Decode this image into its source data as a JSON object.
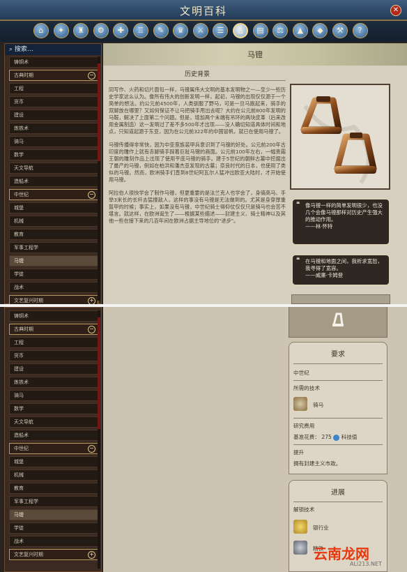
{
  "window": {
    "title": "文明百科",
    "close_icon": "close-icon"
  },
  "category_icons": [
    "home-icon",
    "wonder-icon",
    "civilization-icon",
    "tech-icon",
    "religion-icon",
    "city-icon",
    "culture-icon",
    "great-person-icon",
    "unit-icon",
    "policy-icon",
    "stirrups-icon",
    "building-icon",
    "government-icon",
    "terrain-icon",
    "resource-icon",
    "improvement-icon",
    "concept-icon"
  ],
  "selected_category": 10,
  "sidebar": {
    "search_label": "搜索…",
    "top_items": [
      {
        "label": "铸铜术",
        "type": "item"
      },
      {
        "label": "古典时期",
        "type": "era",
        "toggle": "−"
      },
      {
        "label": "工程",
        "type": "item"
      },
      {
        "label": "货币",
        "type": "item"
      },
      {
        "label": "建设",
        "type": "item"
      },
      {
        "label": "炼铁术",
        "type": "item"
      },
      {
        "label": "骑马",
        "type": "item"
      },
      {
        "label": "数学",
        "type": "item"
      },
      {
        "label": "天文导航",
        "type": "item"
      },
      {
        "label": "造船术",
        "type": "item"
      },
      {
        "label": "中世纪",
        "type": "era",
        "toggle": "−"
      },
      {
        "label": "城堡",
        "type": "item"
      },
      {
        "label": "机械",
        "type": "item"
      },
      {
        "label": "教育",
        "type": "item"
      },
      {
        "label": "军事工程学",
        "type": "item"
      },
      {
        "label": "马镫",
        "type": "item",
        "selected": true
      },
      {
        "label": "学徒",
        "type": "item"
      },
      {
        "label": "战术",
        "type": "item"
      },
      {
        "label": "文艺复兴时期",
        "type": "era",
        "toggle": "+"
      }
    ],
    "bottom_items": [
      {
        "label": "铸铜术",
        "type": "item"
      },
      {
        "label": "古典时期",
        "type": "era",
        "toggle": "−"
      },
      {
        "label": "工程",
        "type": "item"
      },
      {
        "label": "货币",
        "type": "item"
      },
      {
        "label": "建设",
        "type": "item"
      },
      {
        "label": "炼铁术",
        "type": "item"
      },
      {
        "label": "骑马",
        "type": "item"
      },
      {
        "label": "数学",
        "type": "item"
      },
      {
        "label": "天文导航",
        "type": "item"
      },
      {
        "label": "造船术",
        "type": "item"
      },
      {
        "label": "中世纪",
        "type": "era",
        "toggle": "−"
      },
      {
        "label": "城堡",
        "type": "item"
      },
      {
        "label": "机械",
        "type": "item"
      },
      {
        "label": "教育",
        "type": "item"
      },
      {
        "label": "军事工程学",
        "type": "item"
      },
      {
        "label": "马镫",
        "type": "item",
        "selected": true
      },
      {
        "label": "学徒",
        "type": "item"
      },
      {
        "label": "战术",
        "type": "item"
      },
      {
        "label": "文艺复兴时期",
        "type": "era",
        "toggle": "+"
      }
    ]
  },
  "article": {
    "title": "马镫",
    "section_heading": "历史背景",
    "paragraphs": [
      "同写作、火药和切片面包一样，马镫属伟大文明的基本发明物之一—至少一些历史学家这么认为。像所有伟大的创新发明一样，起初，马镫的出现仅仅源于一个简单的想法。约公元前4500年，人类驯服了野马，可是一旦马跑起来，骑手的双脚放在哪里？又如何保证不让马把骑手甩出去呢？大约在公元前800年发明的马鞍，解决了上面第二个问题。但是，增加两个末端有吊环的两块皮革（后来改用金属制造）这一发明过了差不多500年才出现——没人确切知道具体时间和地点，只知道起源于东亚，因为在公元前322年的中国冒帆，就已在使用马镫了。",
      "马镫传播得非常快，因为中亚蛮族装甲兵意识到了马镫的好处。公元前200年古印度的雕作上就有赤脚骑手踩着巨趾马镫的画面。公元前100年左右，一幅贵霜王朝的雕刻作品上出现了使用平底马镫的骑手。建于5世纪的朝鲜古墓中挖掘出了最产的马镫，例如在柏洪和潘杰亚发现的古墓；奈良时代的日本，也使用了类似的马镫。然而，欧洲骑手们直到8世纪阿瓦尔人猛冲出欧亚大陆时，才开始使用马镫。",
      "阿拉伯人很快学会了制作马镫，但更重要的是法兰克人也学会了，身骑高马、手举3米长的长杆去猛撞敌人，这样的事没有马镫是无法做到的。尤其是身穿厚重盔甲的时候；事实上，如果没有马镫，中世纪骑士得仰仗仅仅只是骑马也会苦不堪言。就这样，在欧洲诞生了——根据某些描述——封建主义、骑士精神以及其他一些在接下来的几百年间在欧洲占据主导地位的\"进步\"。"
    ]
  },
  "quotes": [
    {
      "text": "像马镫一样的简单发明很少，也没几个会像马镫那样对历史产生强大的推动作用。",
      "attribution": "——林·怀特"
    },
    {
      "text": "在马镫和地面之间，我祈求宽恕，我寻得了宽容。",
      "attribution": "——威廉·卡姆登"
    }
  ],
  "requirements": {
    "title": "要求",
    "era": "中世纪",
    "required_techs_label": "所需的技术",
    "required_tech": "骑马",
    "research_cost_label": "研究费用",
    "base_cost_label": "基准花费：",
    "base_cost_value": "275",
    "science_label": "科技值",
    "upgrade_label": "提升",
    "upgrade_text": "拥有封建主义市政。"
  },
  "progress": {
    "title": "进展",
    "unlock_label": "解锁技术",
    "unlocks": [
      "银行业",
      "精铁"
    ]
  },
  "watermark": {
    "main": "云南龙网",
    "sub": "ALi213.NET"
  },
  "colors": {
    "accent_gold": "#caa85a",
    "scroll_red": "#7a1414",
    "title_blue": "#2c4666"
  }
}
